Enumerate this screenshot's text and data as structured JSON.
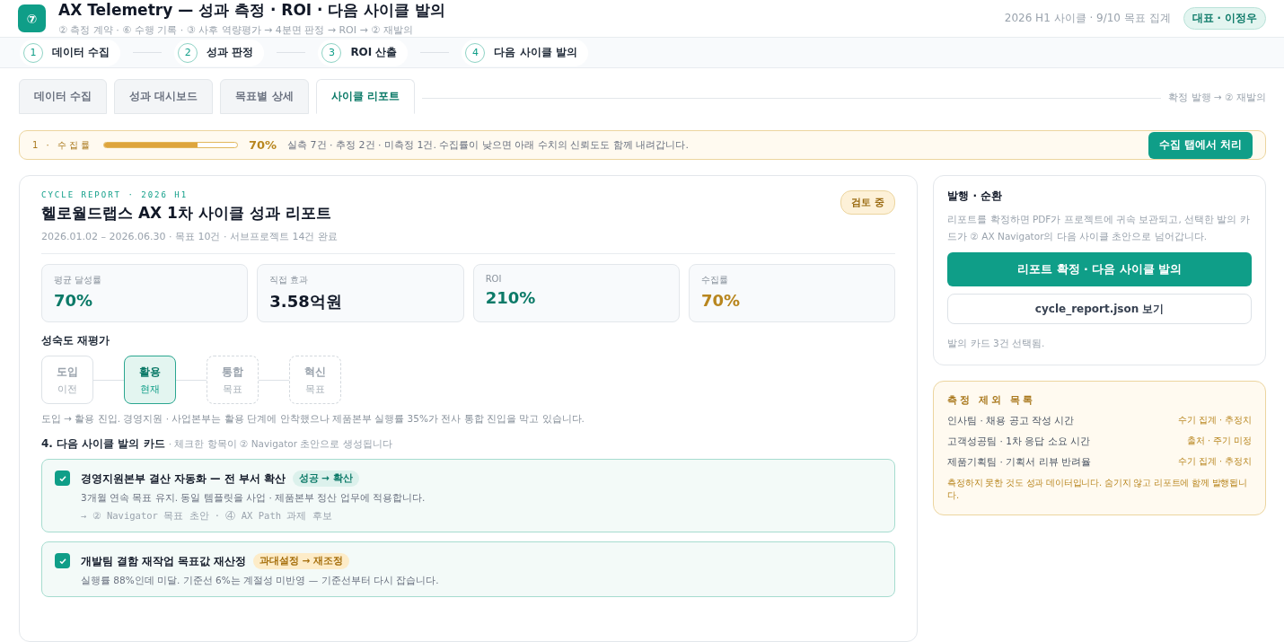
{
  "header": {
    "logo": "⑦",
    "title": "AX Telemetry — 성과 측정 · ROI · 다음 사이클 발의",
    "subtitle": "② 측정 계약 · ⑥ 수행 기록 · ③ 사후 역량평가 → 4분면 판정 → ROI → ② 재발의",
    "cycle": "2026 H1 사이클 · 9/10 목표 집계",
    "user": "대표 · 이정우"
  },
  "steps": [
    {
      "number": "1",
      "label": "데이터 수집"
    },
    {
      "number": "2",
      "label": "성과 판정"
    },
    {
      "number": "3",
      "label": "ROI 산출"
    },
    {
      "number": "4",
      "label": "다음 사이클 발의"
    }
  ],
  "tabs": [
    {
      "label": "데이터 수집",
      "selected": false
    },
    {
      "label": "성과 대시보드",
      "selected": false
    },
    {
      "label": "목표별 상세",
      "selected": false
    },
    {
      "label": "사이클 리포트",
      "selected": true
    }
  ],
  "tabs_note": "확정 발행 → ② 재발의",
  "alert": {
    "label": "1 · 수집률",
    "level": 0.7,
    "value": "70%",
    "message": "실측 7건 · 추정 2건 · 미측정 1건. 수집률이 낮으면 아래 수치의 신뢰도도 함께 내려갑니다.",
    "button": "수집 탭에서 처리"
  },
  "report": {
    "eyebrow": "CYCLE REPORT · 2026 H1",
    "title": "헬로월드랩스 AX 1차 사이클 성과 리포트",
    "meta": "2026.01.02 – 2026.06.30 · 목표 10건 · 서브프로젝트 14건 완료",
    "status": "검토 중",
    "metrics": [
      {
        "label": "평균 달성률",
        "value": "70%",
        "kind": "good"
      },
      {
        "label": "직접 효과",
        "value": "3.58억원",
        "kind": "plain"
      },
      {
        "label": "ROI",
        "value": "210%",
        "kind": "good"
      },
      {
        "label": "수집률",
        "value": "70%",
        "kind": "warn"
      }
    ],
    "maturity_title": "성숙도 재평가",
    "stages": [
      {
        "name": "도입",
        "note": "이전",
        "kind": "past"
      },
      {
        "name": "활용",
        "note": "현재",
        "kind": "current"
      },
      {
        "name": "통합",
        "note": "목표",
        "kind": "target"
      },
      {
        "name": "혁신",
        "note": "목표",
        "kind": "target"
      }
    ],
    "maturity_note": "도입 → 활용 진입. 경영지원 · 사업본부는 활용 단계에 안착했으나 제품본부 실행률 35%가 전사 통합 진입을 막고 있습니다.",
    "cards_title": "4. 다음 사이클 발의 카드",
    "cards_hint": "· 체크한 항목이 ② Navigator 초안으로 생성됩니다",
    "cards": [
      {
        "title": "경영지원본부 결산 자동화 — 전 부서 확산",
        "tag": "성공 → 확산",
        "kind": "success",
        "checked": true,
        "desc": "3개월 연속 목표 유지. 동일 템플릿을 사업 · 제품본부 정산 업무에 적용합니다.",
        "route": "→ ② Navigator 목표 초안 · ④ AX Path 과제 후보"
      },
      {
        "title": "개발팀 결함 재작업 목표값 재산정",
        "tag": "과대설정 → 재조정",
        "kind": "warn",
        "checked": true,
        "desc": "실행률 88%인데 미달. 기준선 6%는 계절성 미반영 — 기준선부터 다시 잡습니다."
      }
    ]
  },
  "publish": {
    "title": "발행 · 순환",
    "desc": "리포트를 확정하면 PDF가 프로젝트에 귀속 보관되고, 선택한 발의 카드가 ② AX Navigator의 다음 사이클 초안으로 넘어갑니다.",
    "primary": "리포트 확정 · 다음 사이클 발의",
    "secondary": "cycle_report.json 보기",
    "note": "발의 카드 3건 선택됨."
  },
  "excluded": {
    "title": "측정 제외 목록",
    "items": [
      {
        "name": "인사팀 · 채용 공고 작성 시간",
        "reason": "수기 집계 · 추정치"
      },
      {
        "name": "고객성공팀 · 1차 응답 소요 시간",
        "reason": "출처 · 주기 미정"
      },
      {
        "name": "제품기획팀 · 기획서 리뷰 반려율",
        "reason": "수기 집계 · 추정치"
      }
    ],
    "footer": "측정하지 못한 것도 성과 데이터입니다. 숨기지 않고 리포트에 함께 발행됩니다."
  }
}
